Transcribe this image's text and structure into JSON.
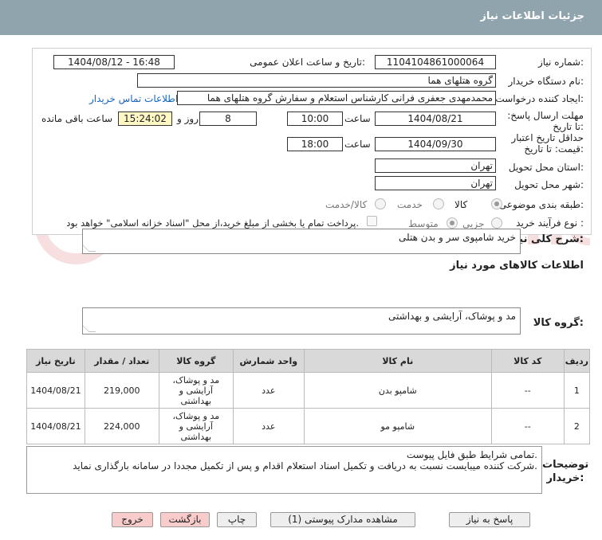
{
  "header": {
    "title": "جزئیات اطلاعات نیاز"
  },
  "fields": {
    "need_number_label": "شماره نیاز:",
    "need_number": "1104104861000064",
    "announce_label": "تاریخ و ساعت اعلان عمومی:",
    "announce_value": "1404/08/12 - 16:48",
    "buyer_org_label": "نام دستگاه خریدار:",
    "buyer_org": "گروه هتلهای هما",
    "creator_label": "ایجاد کننده درخواست:",
    "creator": "محمدمهدی جعفری فرانی کارشناس استعلام و سفارش گروه هتلهای هما",
    "contact_link": "اطلاعات تماس خریدار",
    "deadline_label": "مهلت ارسال پاسخ: تا تاریخ:",
    "deadline_date": "1404/08/21",
    "time_label": "ساعت",
    "deadline_time": "10:00",
    "days_count": "8",
    "days_label": "روز و",
    "remaining_time": "15:24:02",
    "remaining_label": "ساعت باقی مانده",
    "validity_label": "حداقل تاریخ اعتبار قیمت: تا تاریخ:",
    "validity_date": "1404/09/30",
    "validity_time": "18:00",
    "province_label": "استان محل تحویل:",
    "province": "تهران",
    "city_label": "شهر محل تحویل:",
    "city": "تهران",
    "category_label": "طبقه بندی موضوعی:",
    "category_options": [
      "کالا",
      "خدمت",
      "کالا/خدمت"
    ],
    "process_label": "نوع فرآیند خرید :",
    "process_options": [
      "جزیی",
      "متوسط"
    ],
    "payment_note": "پرداخت تمام یا بخشی از مبلغ خرید،از محل \"اسناد خزانه اسلامی\" خواهد بود."
  },
  "summary": {
    "label": "شرح کلی نیاز:",
    "value": "خرید شامپوی سر و بدن هتلی"
  },
  "goods_section_title": "اطلاعات کالاهای مورد نیاز",
  "goods_group": {
    "label": "گروه کالا:",
    "value": "مد و پوشاک، آرایشی و بهداشتی"
  },
  "table": {
    "headers": [
      "ردیف",
      "کد کالا",
      "نام کالا",
      "واحد شمارش",
      "گروه کالا",
      "تعداد / مقدار",
      "تاریخ نیاز"
    ],
    "rows": [
      {
        "row": "1",
        "code": "--",
        "name": "شامپو بدن",
        "unit": "عدد",
        "group": "مد و پوشاک، آرایشی و بهداشتی",
        "qty": "219,000",
        "date": "1404/08/21"
      },
      {
        "row": "2",
        "code": "--",
        "name": "شامپو مو",
        "unit": "عدد",
        "group": "مد و پوشاک، آرایشی و بهداشتی",
        "qty": "224,000",
        "date": "1404/08/21"
      }
    ]
  },
  "notes": {
    "label": "توضیحات خریدار:",
    "line1": "تمامی شرایط طبق فایل پیوست.",
    "line2": "شرکت کننده میبایست نسبت به دریافت و تکمیل اسناد استعلام اقدام و پس از تکمیل مجددا در سامانه بارگذاری نماید."
  },
  "buttons": {
    "reply": "پاسخ به نیاز",
    "attachments": "مشاهده مدارک پیوستی (1)",
    "print": "چاپ",
    "back": "بازگشت",
    "exit": "خروج"
  },
  "watermark_text": "AriaTender.neT"
}
